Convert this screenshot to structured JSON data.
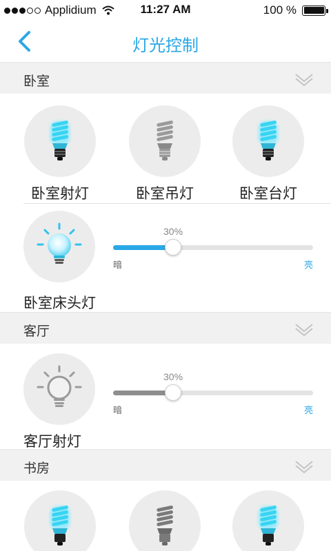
{
  "status": {
    "carrier": "Applidium",
    "time": "11:27 AM",
    "battery": "100 %",
    "signal_bars_filled": 3,
    "signal_bars_total": 5
  },
  "nav": {
    "title": "灯光控制"
  },
  "colors": {
    "accent": "#2aa7e6",
    "bulb_on": "#34d0ee",
    "bulb_off": "#9a9a9a"
  },
  "sections": [
    {
      "label": "卧室",
      "lights": [
        {
          "label": "卧室射灯",
          "icon": "cfl-bulb-on-icon",
          "on": true
        },
        {
          "label": "卧室吊灯",
          "icon": "cfl-bulb-off-icon",
          "on": false
        },
        {
          "label": "卧室台灯",
          "icon": "cfl-bulb-on-icon",
          "on": true
        }
      ],
      "dimmer": {
        "label": "卧室床头灯",
        "icon": "round-bulb-on-icon",
        "on": true,
        "level": 0.3,
        "level_text": "30%",
        "low_label": "暗",
        "high_label": "亮"
      }
    },
    {
      "label": "客厅",
      "dimmer": {
        "label": "客厅射灯",
        "icon": "round-bulb-off-icon",
        "on": false,
        "level": 0.3,
        "level_text": "30%",
        "low_label": "暗",
        "high_label": "亮"
      }
    },
    {
      "label": "书房",
      "lights": [
        {
          "label": "",
          "icon": "cfl-bulb-on-icon",
          "on": true
        },
        {
          "label": "",
          "icon": "cfl-bulb-off-icon",
          "on": false
        },
        {
          "label": "",
          "icon": "cfl-bulb-on-icon",
          "on": true
        }
      ]
    }
  ]
}
